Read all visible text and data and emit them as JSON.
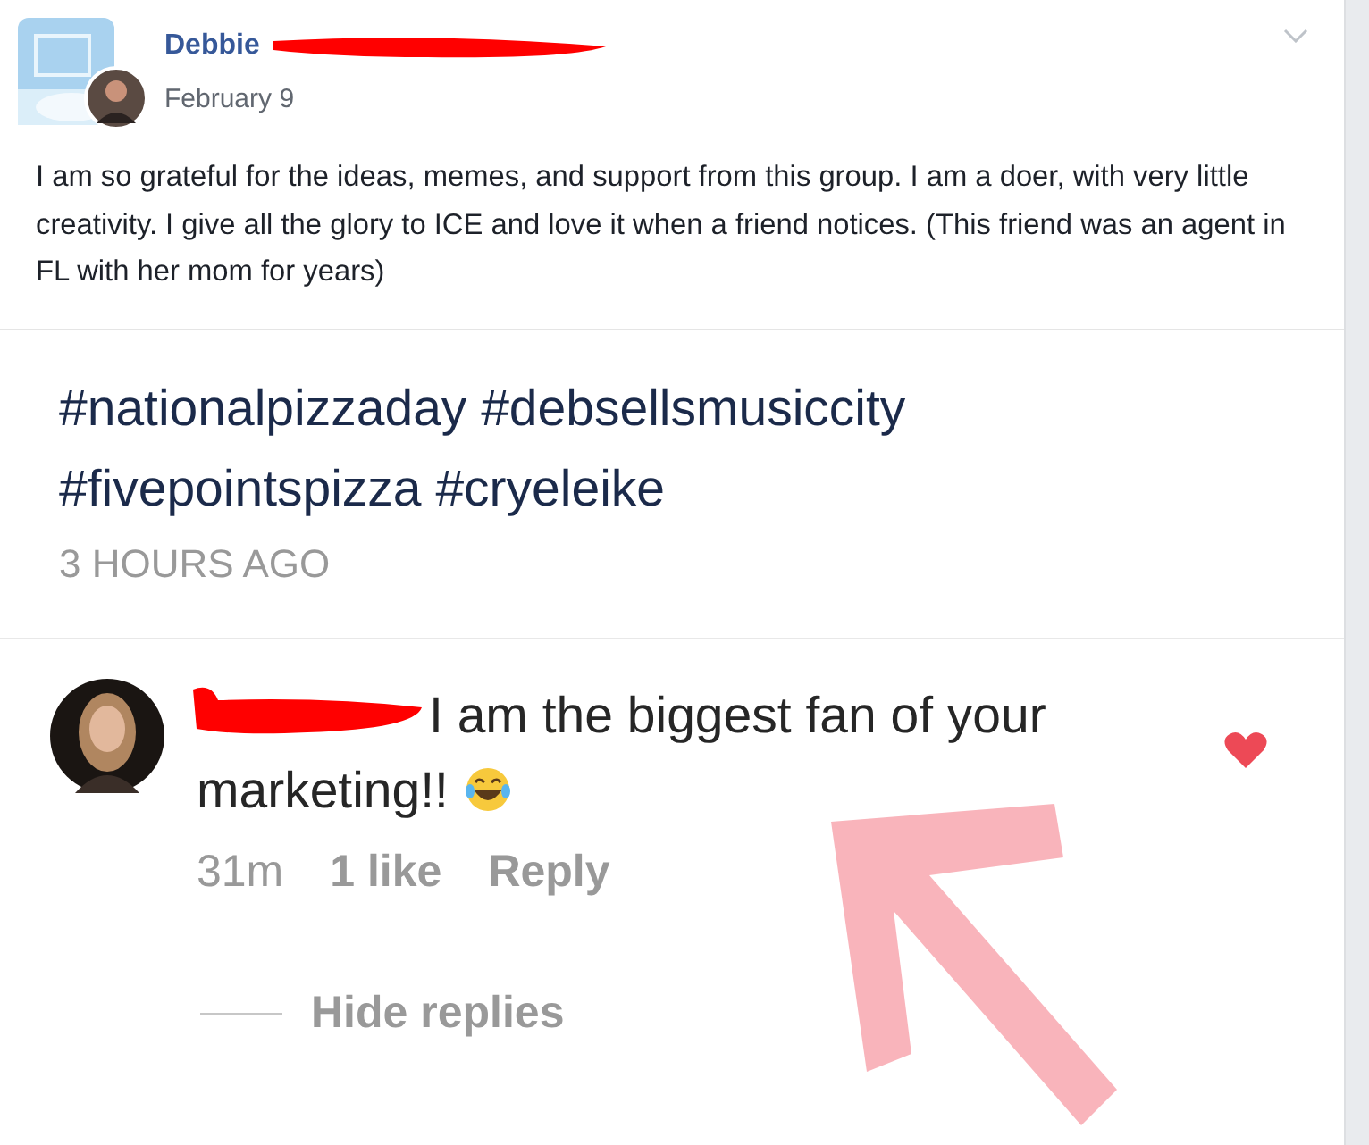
{
  "post": {
    "author": "Debbie",
    "date": "February 9",
    "text": "I am so grateful for the ideas, memes, and support from this group. I am a doer, with very little creativity. I give all the glory to ICE and love it when a friend notices. (This friend was an agent in FL with her mom for years)"
  },
  "embed": {
    "hashtags": "#nationalpizzaday #debsellsmusiccity #fivepointspizza #cryeleike",
    "timestamp": "3 HOURS AGO",
    "comment": {
      "text": "I am the biggest fan of your marketing!!",
      "liked": true,
      "time": "31m",
      "likes": "1 like",
      "reply": "Reply"
    },
    "hide_replies": "Hide replies"
  }
}
